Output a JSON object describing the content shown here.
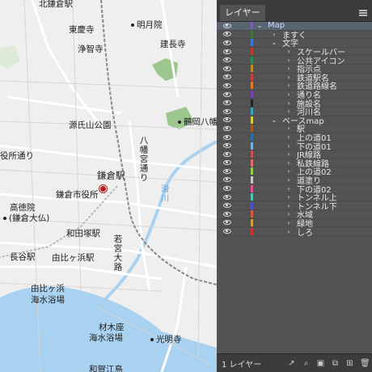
{
  "map": {
    "labels": {
      "kitakamakura": "北鎌倉駅",
      "tokeiji": "東慶寺",
      "meigetsuin": "明月院",
      "jochiji": "浄智寺",
      "kenchoji": "建長寺",
      "genjiyama": "源氏山公園",
      "tsurugaoka": "鶴岡八幡",
      "hachiman_dori": "八幡宮通り",
      "shiyakusho_dori": "役所通り",
      "kamakura_station": "鎌倉駅",
      "city_hall": "鎌倉市役所",
      "nameri": "滑川",
      "kotokuin": "高徳院",
      "daibutsu": "(鎌倉大仏)",
      "wadazuka": "和田塚駅",
      "hase": "長谷駅",
      "yuigahama_st": "由比ヶ浜駅",
      "wakamiya": "若宮大路",
      "yuigahama_beach_1": "由比ヶ浜",
      "yuigahama_beach_2": "海水浴場",
      "zaimokuza_1": "材木座",
      "zaimokuza_2": "海水浴場",
      "komyoji": "光明寺",
      "wakae": "和賀江島"
    }
  },
  "panel": {
    "tab_label": "レイヤー",
    "footer_count": "1 レイヤー",
    "layers": [
      {
        "name": "Map",
        "level": 0,
        "expanded": true,
        "color": "#7a5fb0",
        "selected": true
      },
      {
        "name": "ますく",
        "level": 1,
        "expanded": false,
        "color": "#3b7a3b"
      },
      {
        "name": "文字",
        "level": 1,
        "expanded": true,
        "color": "#3d78d8"
      },
      {
        "name": "スケールバー",
        "level": 2,
        "expanded": false,
        "color": "#c0392b"
      },
      {
        "name": "公共アイコン",
        "level": 2,
        "expanded": false,
        "color": "#2e8b57"
      },
      {
        "name": "指示点",
        "level": 2,
        "expanded": false,
        "color": "#c08a2e"
      },
      {
        "name": "鉄道駅名",
        "level": 2,
        "expanded": false,
        "color": "#d04040"
      },
      {
        "name": "鉄道路線名",
        "level": 2,
        "expanded": false,
        "color": "#e07b2a"
      },
      {
        "name": "通り名",
        "level": 2,
        "expanded": false,
        "color": "#7a3fb0"
      },
      {
        "name": "施設名",
        "level": 2,
        "expanded": false,
        "color": "#222222"
      },
      {
        "name": "河川名",
        "level": 2,
        "expanded": false,
        "color": "#3fa0c8"
      },
      {
        "name": "ベースmap",
        "level": 1,
        "expanded": true,
        "color": "#d8d040"
      },
      {
        "name": "駅",
        "level": 2,
        "expanded": false,
        "color": "#a05a2c"
      },
      {
        "name": "上の道01",
        "level": 2,
        "expanded": false,
        "color": "#2e6db0"
      },
      {
        "name": "下の道01",
        "level": 2,
        "expanded": false,
        "color": "#7ab0e0"
      },
      {
        "name": "JR線路",
        "level": 2,
        "expanded": false,
        "color": "#d05050"
      },
      {
        "name": "私鉄線路",
        "level": 2,
        "expanded": false,
        "color": "#e07070"
      },
      {
        "name": "上の道02",
        "level": 2,
        "expanded": false,
        "color": "#8fd04a"
      },
      {
        "name": "道塗り",
        "level": 2,
        "expanded": false,
        "color": "#c8c8c8"
      },
      {
        "name": "下の道02",
        "level": 2,
        "expanded": false,
        "color": "#e05090"
      },
      {
        "name": "トンネル上",
        "level": 2,
        "expanded": false,
        "color": "#50c0b0"
      },
      {
        "name": "トンネル下",
        "level": 2,
        "expanded": false,
        "color": "#5050d0"
      },
      {
        "name": "水域",
        "level": 2,
        "expanded": false,
        "color": "#d06040"
      },
      {
        "name": "緑地",
        "level": 2,
        "expanded": false,
        "color": "#d0a040"
      },
      {
        "name": "しろ",
        "level": 2,
        "expanded": false,
        "color": "#d03030"
      }
    ]
  }
}
